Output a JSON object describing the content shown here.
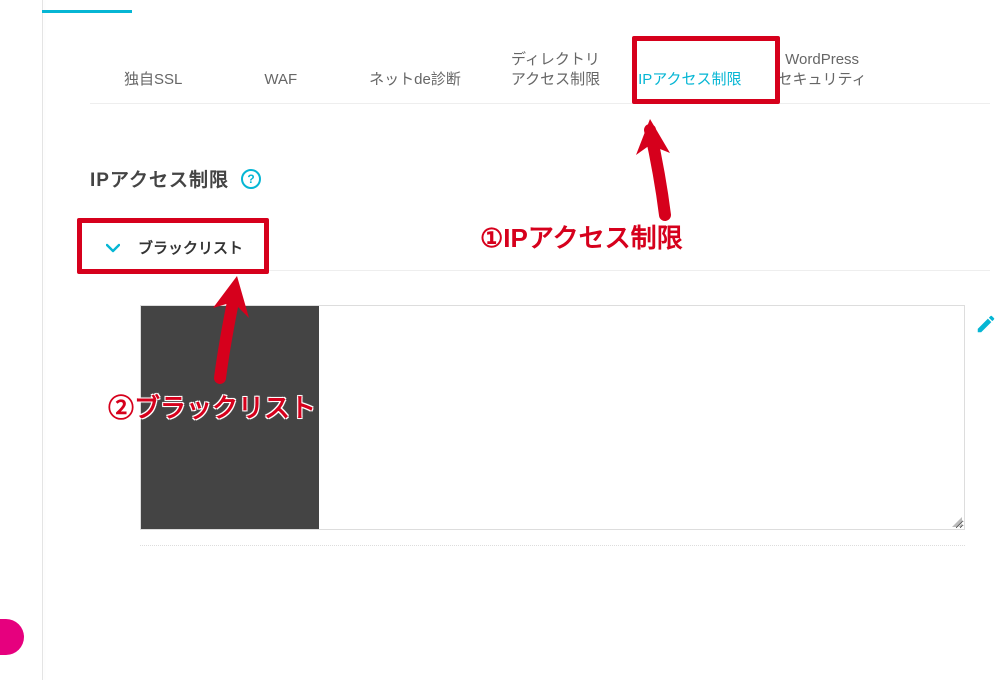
{
  "tabs": [
    {
      "label": "独自SSL"
    },
    {
      "label": "WAF"
    },
    {
      "label": "ネットde診断"
    },
    {
      "label": "ディレクトリ\nアクセス制限"
    },
    {
      "label": "IPアクセス制限",
      "active": true
    },
    {
      "label": "WordPress\nセキュリティ"
    }
  ],
  "page_title": "IPアクセス制限",
  "help_symbol": "?",
  "accordion": {
    "label": "ブラックリスト"
  },
  "annotations": {
    "a1": "①IPアクセス制限",
    "a2": "②ブラックリスト"
  }
}
